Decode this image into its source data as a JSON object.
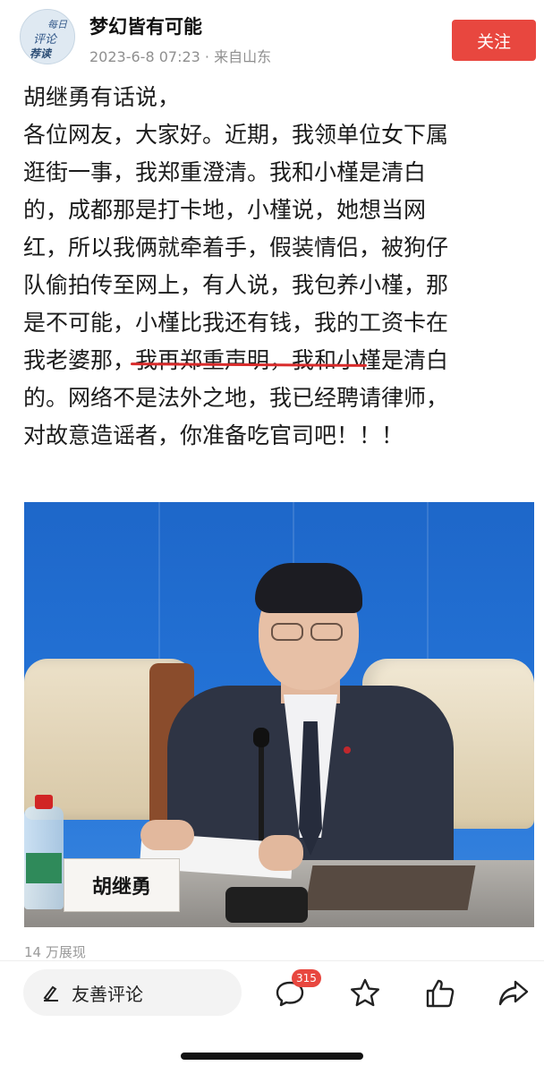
{
  "header": {
    "avatar_text": [
      "每日",
      "评论",
      "荐读"
    ],
    "account_name": "梦幻皆有可能",
    "meta": "2023-6-8 07:23 · 来自山东",
    "follow_label": "关注"
  },
  "post": {
    "lines": [
      "胡继勇有话说，",
      "各位网友，大家好。近期，我领单位女下属",
      "逛街一事，我郑重澄清。我和小槿是清白",
      "的，成都那是打卡地，小槿说，她想当网",
      "红，所以我俩就牵着手，假装情侣，被狗仔",
      "队偷拍传至网上，有人说，我包养小槿，那",
      "是不可能，小槿比我还有钱，我的工资卡在",
      "我老婆那，我再郑重声明，我和小槿是清白",
      "的。网络不是法外之地，我已经聘请律师，",
      "对故意造谣者，你准备吃官司吧！！！"
    ]
  },
  "photo": {
    "nameplate": "胡继勇"
  },
  "stats": {
    "views": "14 万展现"
  },
  "actions": {
    "comment_placeholder": "友善评论",
    "comment_count": "315"
  },
  "colors": {
    "accent": "#e8473f",
    "highlight_underline": "#d92b2b",
    "meta_gray": "#8f8f8f"
  }
}
